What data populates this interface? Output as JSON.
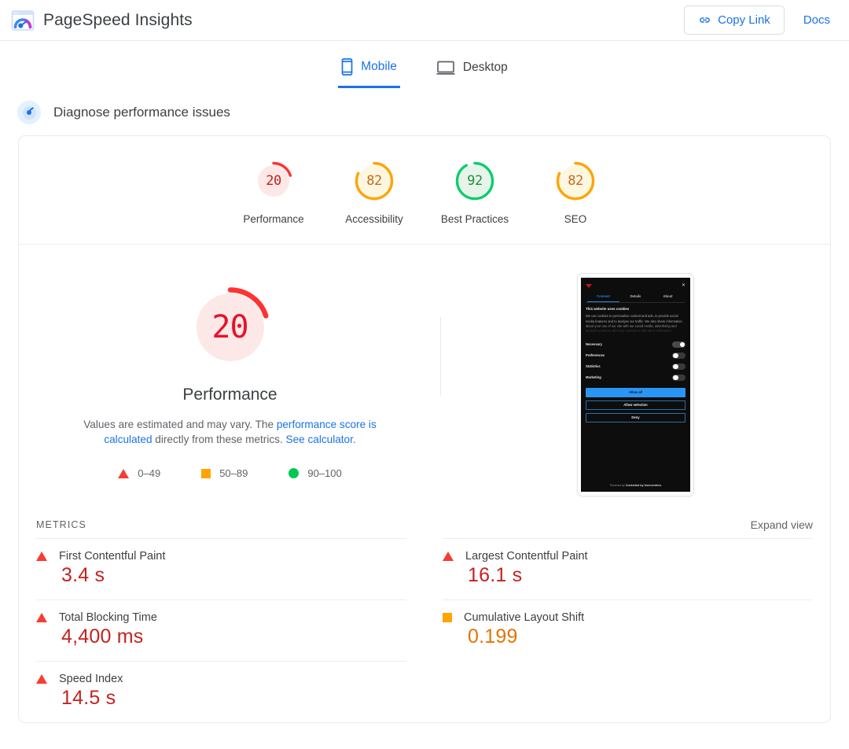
{
  "header": {
    "title": "PageSpeed Insights",
    "logo_icon": "pagespeed-logo-icon",
    "copy_link_label": "Copy Link",
    "copy_link_icon": "link-icon",
    "docs_label": "Docs"
  },
  "tabs": [
    {
      "label": "Mobile",
      "icon": "mobile-phone-icon",
      "active": true
    },
    {
      "label": "Desktop",
      "icon": "desktop-monitor-icon",
      "active": false
    }
  ],
  "diagnose": {
    "title": "Diagnose performance issues",
    "icon": "speedometer-icon"
  },
  "categories": [
    {
      "label": "Performance",
      "score": "20",
      "color": "#f33",
      "fill": "#fce8e6",
      "text": "#c5221f",
      "pct": 20
    },
    {
      "label": "Accessibility",
      "score": "82",
      "color": "#ffa400",
      "fill": "#fef7e0",
      "text": "#c5691f",
      "pct": 82
    },
    {
      "label": "Best Practices",
      "score": "92",
      "color": "#0cce6b",
      "fill": "#e6f4ea",
      "text": "#1e8e3e",
      "pct": 92
    },
    {
      "label": "SEO",
      "score": "82",
      "color": "#ffa400",
      "fill": "#fef7e0",
      "text": "#c5691f",
      "pct": 82
    }
  ],
  "hero": {
    "score": "20",
    "score_pct": 20,
    "label": "Performance",
    "desc_part1": "Values are estimated and may vary. The ",
    "desc_link1": "performance score is calculated",
    "desc_part2": " directly from these metrics. ",
    "desc_link2": "See calculator.",
    "legend": [
      {
        "icon": "triangle-red-icon",
        "range": "0–49"
      },
      {
        "icon": "square-orange-icon",
        "range": "50–89"
      },
      {
        "icon": "circle-green-icon",
        "range": "90–100"
      }
    ]
  },
  "thumbnail": {
    "close_icon": "close-icon",
    "logo_icon": "site-logo-icon",
    "tabs": [
      "Consent",
      "Details",
      "About"
    ],
    "heading": "This website uses cookies",
    "body": "We use cookies to personalise content and ads, to provide social media features and to analyse our traffic. We also share information about your use of our site with our social media, advertising and analytics partners who may combine it with other information.",
    "toggles": [
      {
        "label": "Necessary",
        "on": true
      },
      {
        "label": "Preferences",
        "on": false
      },
      {
        "label": "Statistics",
        "on": false
      },
      {
        "label": "Marketing",
        "on": false
      }
    ],
    "buttons": [
      {
        "label": "Allow all",
        "style": "primary"
      },
      {
        "label": "Allow selection",
        "style": "outline"
      },
      {
        "label": "Deny",
        "style": "outline"
      }
    ],
    "footer_prefix": "Powered by ",
    "footer_brand": "Cookiebot by Usercentrics"
  },
  "metrics": {
    "section_title": "METRICS",
    "expand_label": "Expand view",
    "items": [
      {
        "name": "First Contentful Paint",
        "value": "3.4 s",
        "icon": "triangle-red-icon",
        "severity": "red"
      },
      {
        "name": "Largest Contentful Paint",
        "value": "16.1 s",
        "icon": "triangle-red-icon",
        "severity": "red"
      },
      {
        "name": "Total Blocking Time",
        "value": "4,400 ms",
        "icon": "triangle-red-icon",
        "severity": "red"
      },
      {
        "name": "Cumulative Layout Shift",
        "value": "0.199",
        "icon": "square-orange-icon",
        "severity": "orange"
      },
      {
        "name": "Speed Index",
        "value": "14.5 s",
        "icon": "triangle-red-icon",
        "severity": "red"
      }
    ]
  },
  "colors": {
    "blue": "#1a73e8",
    "red": "#f33",
    "orange": "#ffa400",
    "green": "#0cce6b"
  }
}
